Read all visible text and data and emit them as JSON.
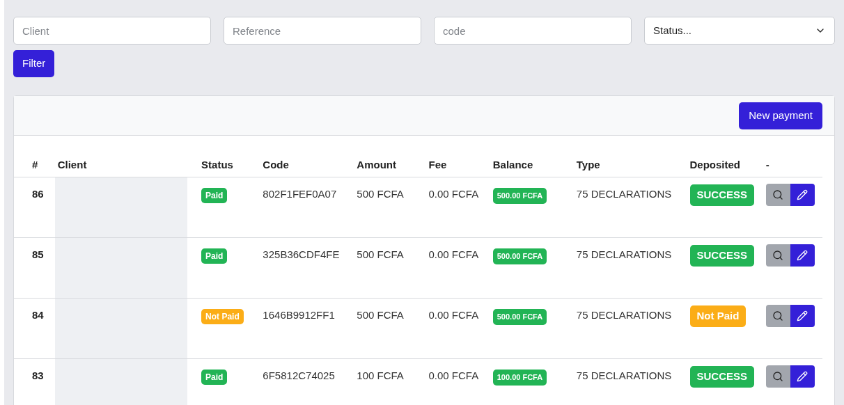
{
  "filters": {
    "client": {
      "placeholder": "Client"
    },
    "reference": {
      "placeholder": "Reference"
    },
    "code": {
      "placeholder": "code"
    },
    "status": {
      "value": "Status..."
    },
    "button": "Filter"
  },
  "new_payment": "New payment",
  "table": {
    "columns": [
      "#",
      "Client",
      "Status",
      "Code",
      "Amount",
      "Fee",
      "Balance",
      "Type",
      "Deposited",
      "-"
    ],
    "rows": [
      {
        "id": "86",
        "status": {
          "label": "Paid",
          "kind": "paid"
        },
        "code": "802F1FEF0A07",
        "amount": "500 FCFA",
        "fee": "0.00 FCFA",
        "balance": "500.00 FCFA",
        "type": "75 DECLARATIONS",
        "deposited": {
          "label": "SUCCESS",
          "kind": "success"
        }
      },
      {
        "id": "85",
        "status": {
          "label": "Paid",
          "kind": "paid"
        },
        "code": "325B36CDF4FE",
        "amount": "500 FCFA",
        "fee": "0.00 FCFA",
        "balance": "500.00 FCFA",
        "type": "75 DECLARATIONS",
        "deposited": {
          "label": "SUCCESS",
          "kind": "success"
        }
      },
      {
        "id": "84",
        "status": {
          "label": "Not Paid",
          "kind": "unpaid"
        },
        "code": "1646B9912FF1",
        "amount": "500 FCFA",
        "fee": "0.00 FCFA",
        "balance": "500.00 FCFA",
        "type": "75 DECLARATIONS",
        "deposited": {
          "label": "Not Paid",
          "kind": "unpaid"
        }
      },
      {
        "id": "83",
        "status": {
          "label": "Paid",
          "kind": "paid"
        },
        "code": "6F5812C74025",
        "amount": "100 FCFA",
        "fee": "0.00 FCFA",
        "balance": "100.00 FCFA",
        "type": "75 DECLARATIONS",
        "deposited": {
          "label": "SUCCESS",
          "kind": "success"
        }
      }
    ]
  }
}
